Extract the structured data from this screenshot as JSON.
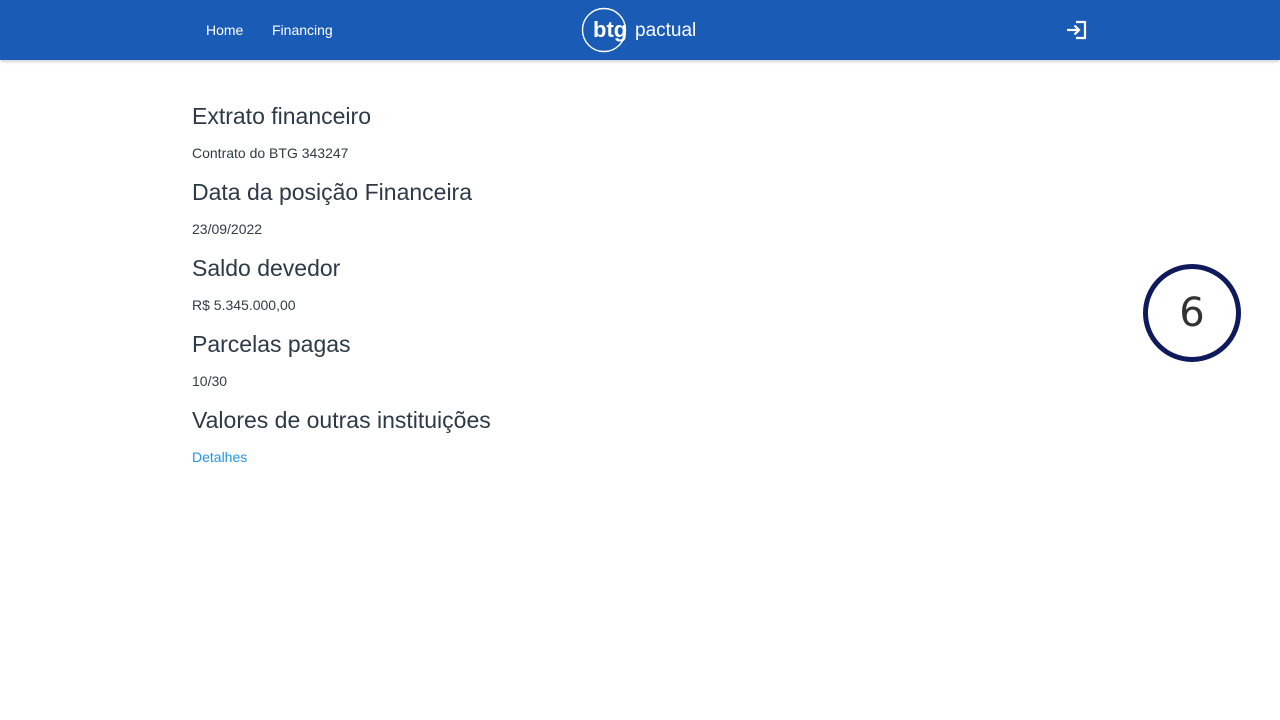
{
  "nav": {
    "links": [
      {
        "label": "Home"
      },
      {
        "label": "Financing"
      }
    ],
    "logo": {
      "brand_primary": "btg",
      "brand_secondary": "pactual"
    },
    "login_icon": "login-arrow-icon"
  },
  "statement": {
    "sections": [
      {
        "title": "Extrato financeiro",
        "value": "Contrato do BTG 343247"
      },
      {
        "title": "Data da posição Financeira",
        "value": "23/09/2022"
      },
      {
        "title": "Saldo devedor",
        "value": "R$ 5.345.000,00"
      },
      {
        "title": "Parcelas pagas",
        "value": "10/30"
      },
      {
        "title": "Valores de outras instituições",
        "link_label": "Detalhes"
      }
    ]
  },
  "step_badge": {
    "number": "6"
  },
  "colors": {
    "navbar": "#1a5bb6",
    "link": "#2196e6",
    "badge_border": "#0e1a5c",
    "heading": "#2c3a47"
  }
}
